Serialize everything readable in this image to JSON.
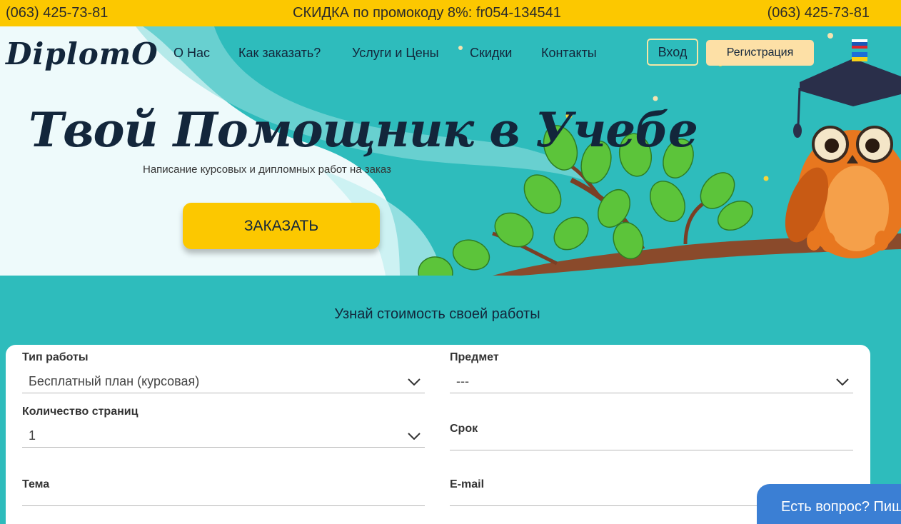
{
  "topbar": {
    "phone_left": "(063) 425-73-81",
    "promo": "СКИДКА по промокоду 8%: fr054-134541",
    "phone_right": "(063) 425-73-81"
  },
  "brand": {
    "logo": "DiplomO"
  },
  "nav": {
    "items": [
      "О Нас",
      "Как заказать?",
      "Услуги и Цены",
      "Скидки",
      "Контакты"
    ],
    "login": "Вход",
    "register": "Регистрация"
  },
  "hero": {
    "headline": "Твой Помощник в Учебе",
    "subline": "Написание курсовых и дипломных работ на заказ",
    "order_button": "ЗАКАЗАТЬ"
  },
  "calculator": {
    "title": "Узнай стоимость своей работы",
    "fields": {
      "work_type": {
        "label": "Тип работы",
        "value": "Бесплатный план (курсовая)"
      },
      "subject": {
        "label": "Предмет",
        "value": "---"
      },
      "pages": {
        "label": "Количество страниц",
        "value": "1"
      },
      "deadline": {
        "label": "Срок",
        "value": ""
      },
      "topic": {
        "label": "Тема",
        "value": ""
      },
      "email": {
        "label": "E-mail",
        "value": ""
      }
    }
  },
  "chat": {
    "label": "Есть вопрос? Пишите!"
  },
  "colors": {
    "accent_yellow": "#fcc800",
    "teal": "#2ebcbc",
    "navy": "#13263b",
    "chat_blue": "#3b7fd4"
  },
  "icons": {
    "chevron": "chevron-down-icon",
    "chat": "chat-bubbles-icon",
    "flags": [
      "flag-ru-icon",
      "flag-ua-icon"
    ]
  }
}
